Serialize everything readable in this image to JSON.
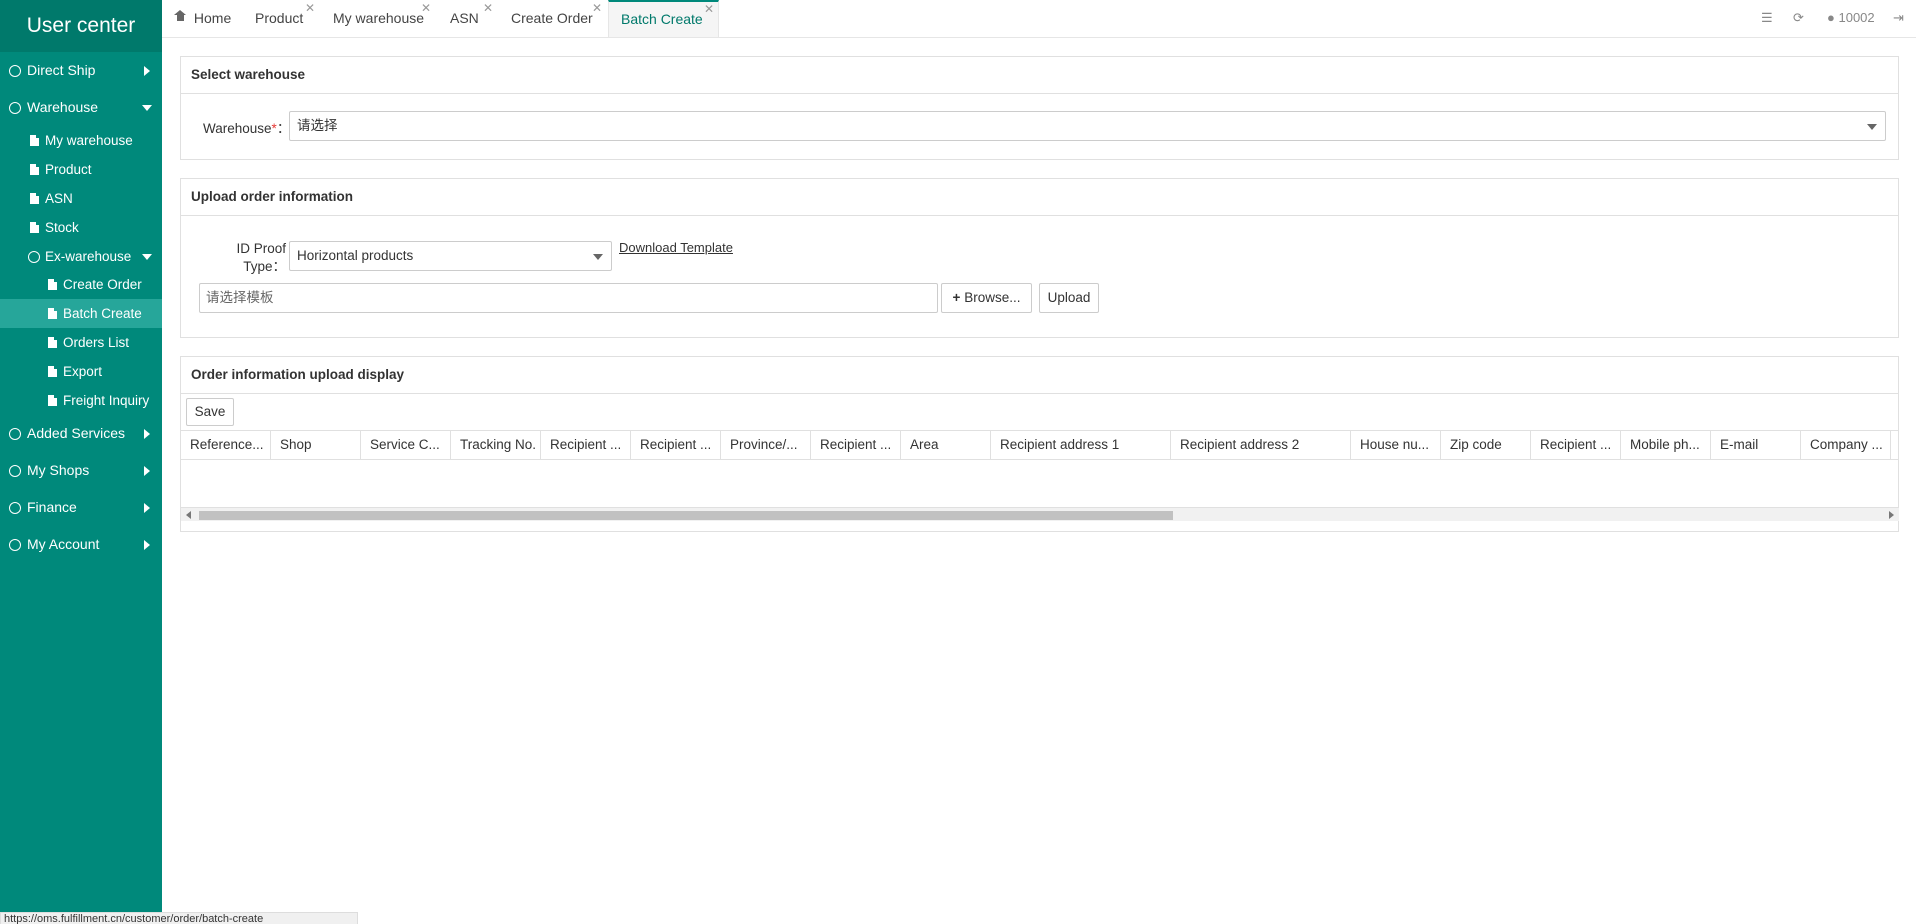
{
  "sidebar": {
    "brand": "User center",
    "items": [
      {
        "label": "Direct Ship"
      },
      {
        "label": "Warehouse"
      },
      {
        "label": "Added Services"
      },
      {
        "label": "My Shops"
      },
      {
        "label": "Finance"
      },
      {
        "label": "My Account"
      }
    ],
    "warehouse_sub": [
      {
        "label": "My warehouse"
      },
      {
        "label": "Product"
      },
      {
        "label": "ASN"
      },
      {
        "label": "Stock"
      },
      {
        "label": "Ex-warehouse"
      }
    ],
    "ex_warehouse_sub": [
      {
        "label": "Create Order"
      },
      {
        "label": "Batch Create"
      },
      {
        "label": "Orders List"
      },
      {
        "label": "Export"
      },
      {
        "label": "Freight Inquiry"
      }
    ]
  },
  "tabs": [
    {
      "label": "Home"
    },
    {
      "label": "Product"
    },
    {
      "label": "My warehouse"
    },
    {
      "label": "ASN"
    },
    {
      "label": "Create Order"
    },
    {
      "label": "Batch Create"
    }
  ],
  "toolbar": {
    "user_id": "10002"
  },
  "warehouse_panel": {
    "title": "Select warehouse",
    "warehouse_label": "Warehouse",
    "required_mark": "*",
    "label_suffix": "：",
    "warehouse_value": "请选择"
  },
  "upload_panel": {
    "title": "Upload order information",
    "id_proof_label_line1": "ID Proof",
    "id_proof_label_line2": "Type：",
    "id_proof_value": "Horizontal products",
    "download_template": "Download Template",
    "file_placeholder": "请选择模板",
    "browse_label": "Browse...",
    "upload_label": "Upload"
  },
  "display_panel": {
    "title": "Order information upload display",
    "save_label": "Save",
    "columns": [
      "Reference...",
      "Shop",
      "Service C...",
      "Tracking No.",
      "Recipient ...",
      "Recipient ...",
      "Province/...",
      "Recipient ...",
      "Area",
      "Recipient address 1",
      "Recipient address 2",
      "House nu...",
      "Zip code",
      "Recipient ...",
      "Mobile ph...",
      "E-mail",
      "Company ..."
    ]
  },
  "status_bar": {
    "url": "https://oms.fulfillment.cn/customer/order/batch-create"
  },
  "colors": {
    "sidebar_bg": "#00897b",
    "brand_bg": "#00796b",
    "active_item_bg": "#26a69a",
    "active_tab_text": "#00796b"
  }
}
